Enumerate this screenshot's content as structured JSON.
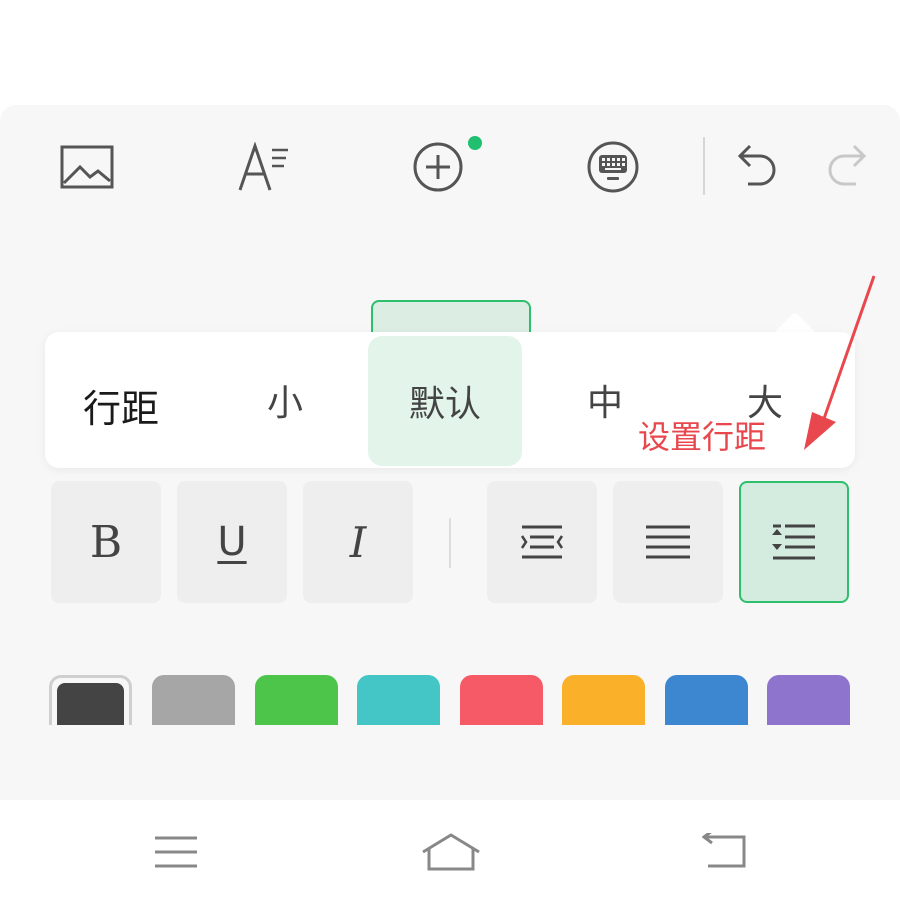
{
  "toolbar": {
    "icons": [
      "image-icon",
      "text-format-icon",
      "add-circle-icon",
      "keyboard-icon",
      "undo-icon",
      "redo-icon"
    ],
    "add_badge_color": "#20c070"
  },
  "line_spacing_popup": {
    "title": "行距",
    "options": [
      {
        "label": "小",
        "selected": false
      },
      {
        "label": "默认",
        "selected": true
      },
      {
        "label": "中",
        "selected": false
      },
      {
        "label": "大",
        "selected": false
      }
    ]
  },
  "annotation": {
    "text": "设置行距",
    "color": "#e8484d"
  },
  "format_buttons": [
    {
      "name": "bold",
      "label": "B"
    },
    {
      "name": "underline",
      "label": "U"
    },
    {
      "name": "italic",
      "label": "I"
    },
    {
      "name": "indent",
      "label": ""
    },
    {
      "name": "align",
      "label": ""
    },
    {
      "name": "line-spacing",
      "label": "",
      "selected": true
    }
  ],
  "colors": [
    "#444444",
    "#a6a6a6",
    "#4cc54a",
    "#44c6c6",
    "#f65a66",
    "#fbb02a",
    "#3c87d0",
    "#8e74cc"
  ],
  "accent_color": "#2dbf6c",
  "navbar": {
    "icons": [
      "menu-icon",
      "home-icon",
      "back-icon"
    ]
  }
}
